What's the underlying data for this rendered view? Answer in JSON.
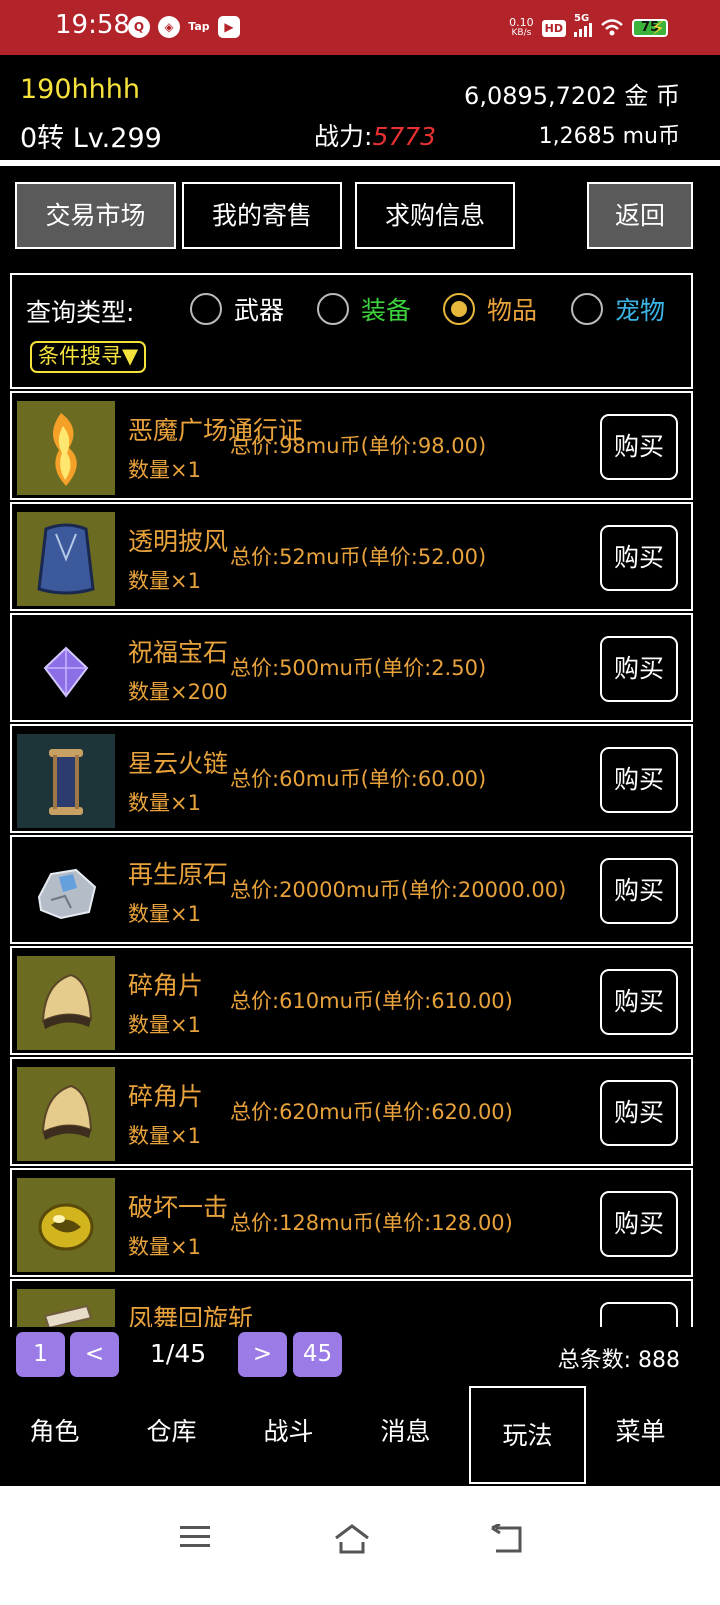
{
  "status": {
    "time": "19:58",
    "netspeed_value": "0.10",
    "netspeed_unit": "KB/s",
    "hd": "HD",
    "signal": "5G",
    "battery": "75",
    "icon_names": [
      "app-icon-q",
      "app-icon-compass",
      "taptap-icon",
      "play-icon",
      "hd-icon",
      "signal-icon",
      "wifi-icon",
      "battery-icon",
      "charging-icon"
    ]
  },
  "header": {
    "player_name": "190hhhh",
    "level": "0转 Lv.299",
    "power_label": "战力:",
    "power_value": "5773",
    "gold": "6,0895,7202 金  币",
    "mu_coin": "1,2685 mu币"
  },
  "top_buttons": {
    "market": "交易市场",
    "my_sales": "我的寄售",
    "wanted": "求购信息",
    "back": "返回"
  },
  "filter": {
    "label": "查询类型:",
    "options": [
      {
        "label": "武器",
        "color": "#ffffff",
        "selected": false
      },
      {
        "label": "装备",
        "color": "#3cd23c",
        "selected": false
      },
      {
        "label": "物品",
        "color": "#e8a23c",
        "selected": true
      },
      {
        "label": "宠物",
        "color": "#3cb4e6",
        "selected": false
      }
    ],
    "condition_button": "条件搜寻▼"
  },
  "items": [
    {
      "name": "恶魔广场通行证",
      "qty": "数量×1",
      "price": "总价:98mu币(单价:98.00)",
      "buy": "购买",
      "icon": "flame-scroll-icon"
    },
    {
      "name": "透明披风",
      "qty": "数量×1",
      "price": "总价:52mu币(单价:52.00)",
      "buy": "购买",
      "icon": "cloak-icon"
    },
    {
      "name": "祝福宝石",
      "qty": "数量×200",
      "price": "总价:500mu币(单价:2.50)",
      "buy": "购买",
      "icon": "gem-icon"
    },
    {
      "name": "星云火链",
      "qty": "数量×1",
      "price": "总价:60mu币(单价:60.00)",
      "buy": "购买",
      "icon": "chain-scroll-icon"
    },
    {
      "name": "再生原石",
      "qty": "数量×1",
      "price": "总价:20000mu币(单价:20000.00)",
      "buy": "购买",
      "icon": "ore-icon"
    },
    {
      "name": "碎角片",
      "qty": "数量×1",
      "price": "总价:610mu币(单价:610.00)",
      "buy": "购买",
      "icon": "horn-fragment-icon"
    },
    {
      "name": "碎角片",
      "qty": "数量×1",
      "price": "总价:620mu币(单价:620.00)",
      "buy": "购买",
      "icon": "horn-fragment-icon"
    },
    {
      "name": "破坏一击",
      "qty": "数量×1",
      "price": "总价:128mu币(单价:128.00)",
      "buy": "购买",
      "icon": "orb-icon"
    },
    {
      "name": "凤舞回旋斩",
      "qty": "",
      "price": "",
      "buy": "",
      "icon": "skill-book-icon"
    }
  ],
  "pagination": {
    "first": "1",
    "prev": "<",
    "current": "1/45",
    "next": ">",
    "last": "45",
    "total": "总条数: 888"
  },
  "nav": [
    "角色",
    "仓库",
    "战斗",
    "消息",
    "玩法",
    "菜单"
  ],
  "active_nav": "玩法",
  "system_nav": [
    "menu-icon",
    "home-icon",
    "back-icon"
  ]
}
